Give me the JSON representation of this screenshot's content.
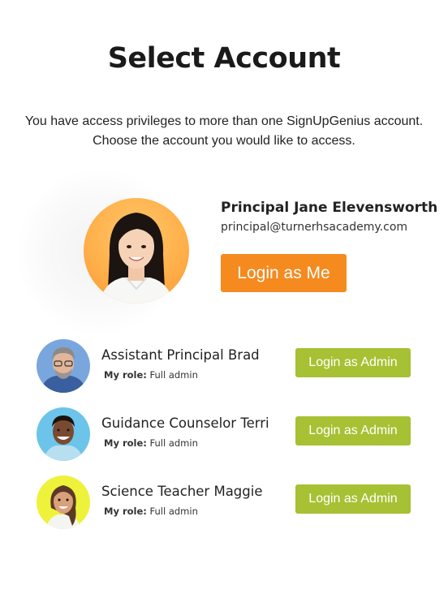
{
  "header": {
    "title": "Select Account"
  },
  "intro": {
    "line1": "You have access privileges to more than one SignUpGenius account.",
    "line2": "Choose the account you would like to access."
  },
  "primary_account": {
    "name": "Principal Jane Elevensworth",
    "email": "principal@turnerhsacademy.com",
    "button_label": "Login as Me",
    "button_color": "#f58a1f"
  },
  "accounts": [
    {
      "name": "Assistant Principal Brad",
      "role_label": "My role:",
      "role": "Full admin",
      "button_label": "Login as Admin"
    },
    {
      "name": "Guidance Counselor Terri",
      "role_label": "My role:",
      "role": "Full admin",
      "button_label": "Login as Admin"
    },
    {
      "name": "Science Teacher Maggie",
      "role_label": "My role:",
      "role": "Full admin",
      "button_label": "Login as Admin"
    }
  ],
  "colors": {
    "admin_button": "#a6c133",
    "primary_button": "#f58a1f"
  }
}
